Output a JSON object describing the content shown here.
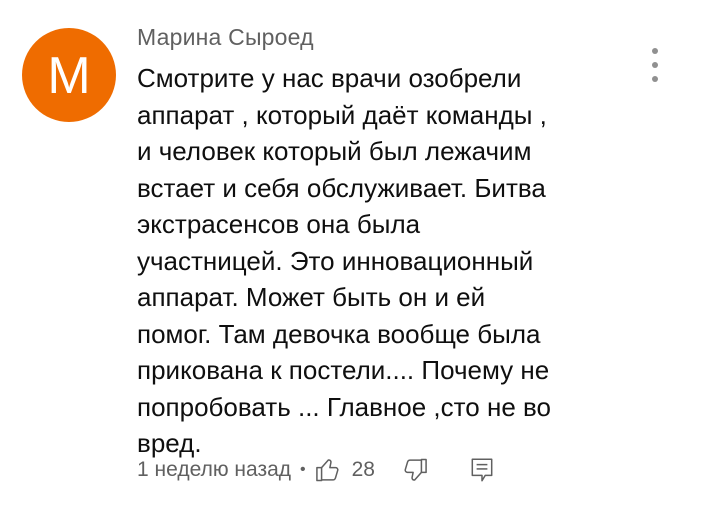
{
  "comment": {
    "avatar_letter": "М",
    "avatar_color": "#ef6c00",
    "author": "Марина Сыроед",
    "text": "Смотрите у нас врачи озобрели\nаппарат , который даёт команды ,\nи человек который был лежачим\nвстает и себя обслуживает. Битва\nэкстрасенсов она была\nучастницей. Это инновационный\nаппарат. Может быть он и ей\nпомог. Там девочка вообще была\nприкована к постели.... Почему не\nпопробовать ... Главное ,сто не во\nвред.",
    "timestamp": "1 неделю назад",
    "separator": "•",
    "like_count": "28",
    "icons": {
      "like": "thumb-up-icon",
      "dislike": "thumb-down-icon",
      "reply": "reply-icon",
      "menu": "more-vert-icon"
    }
  }
}
